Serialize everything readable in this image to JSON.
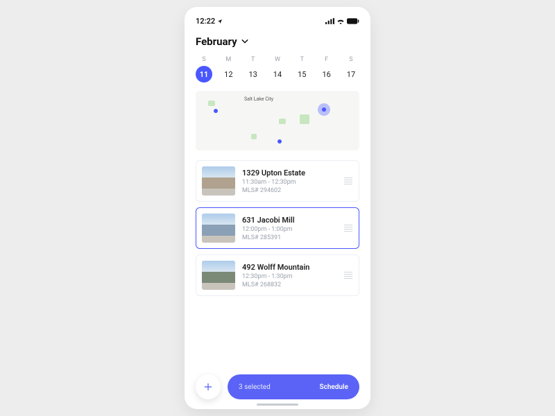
{
  "status": {
    "time": "12:22"
  },
  "header": {
    "month": "February"
  },
  "week": {
    "dows": [
      "S",
      "M",
      "T",
      "W",
      "T",
      "F",
      "S"
    ],
    "dates": [
      "11",
      "12",
      "13",
      "14",
      "15",
      "16",
      "17"
    ],
    "selected_index": 0
  },
  "map": {
    "city_label": "Salt Lake City"
  },
  "listings": [
    {
      "title": "1329 Upton Estate",
      "time": "11:30am - 12:30pm",
      "mls": "MLS# 294602",
      "active": false
    },
    {
      "title": "631 Jacobi Mill",
      "time": "12:00pm - 1:00pm",
      "mls": "MLS# 285391",
      "active": true
    },
    {
      "title": "492 Wolff Mountain",
      "time": "12:30pm - 1:30pm",
      "mls": "MLS# 268832",
      "active": false
    }
  ],
  "bottom": {
    "count_text": "3 selected",
    "action_text": "Schedule"
  }
}
